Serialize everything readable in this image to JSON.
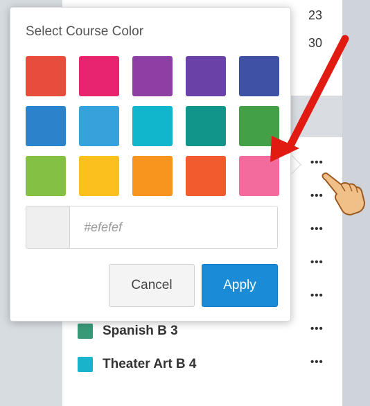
{
  "background": {
    "dates": [
      "23",
      "30"
    ],
    "menu_glyph": "•••",
    "courses": [
      {
        "name": "Spanish B 3",
        "color": "#3a9a78"
      },
      {
        "name": "Theater Art B 4",
        "color": "#1ab3cc"
      }
    ]
  },
  "color_picker": {
    "title": "Select Course Color",
    "swatches": [
      "#e84c3d",
      "#e8246f",
      "#8e3fa3",
      "#6a42a7",
      "#3f51a5",
      "#2b84cb",
      "#35a2db",
      "#11b5cc",
      "#11958a",
      "#43a047",
      "#84c043",
      "#fbc01d",
      "#f7951f",
      "#f15b2e",
      "#f26b9c"
    ],
    "hex_placeholder": "#efefef",
    "preview_color": "#efefef",
    "cancel_label": "Cancel",
    "apply_label": "Apply"
  },
  "annotation": {
    "arrow_color": "#e11b12",
    "pointer_icon": "pointing-hand-icon"
  }
}
